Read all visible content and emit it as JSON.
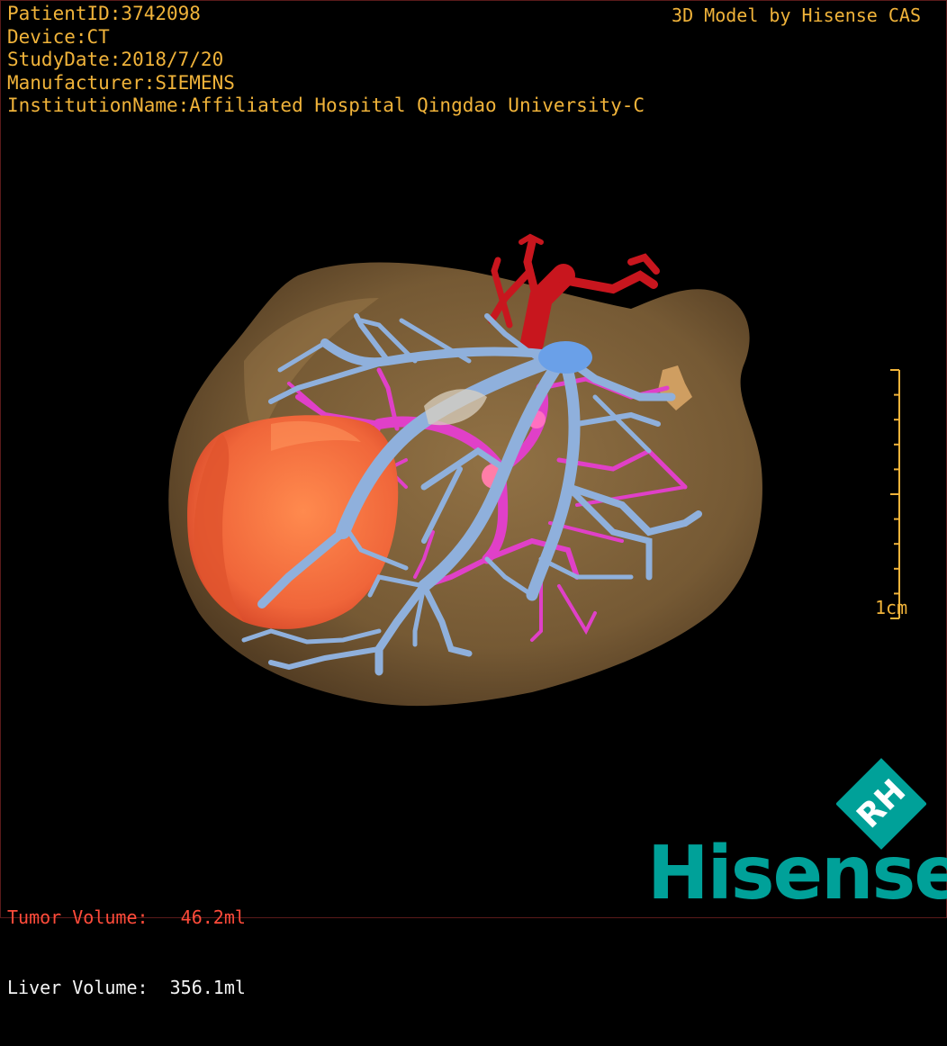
{
  "study": {
    "patient_id": "PatientID:3742098",
    "device": "Device:CT",
    "study_date": "StudyDate:2018/7/20",
    "manufacturer": "Manufacturer:SIEMENS",
    "institution": "InstitutionName:Affiliated Hospital Qingdao University-C"
  },
  "credit": "3D Model by Hisense CAS",
  "scale_bar": {
    "label": "1cm"
  },
  "volumes": {
    "tumor": "Tumor Volume:   46.2ml",
    "liver": "Liver Volume:  356.1ml"
  },
  "brand": {
    "wordmark": "Hisense",
    "emblem_text": "RH",
    "color": "#00a199"
  },
  "colors": {
    "overlay_text": "#f0b33a",
    "tumor_text": "#ff4b3a",
    "liver": "#8a6a3e",
    "tumor": "#f26a3a",
    "hepatic_vein": "#8fb0dc",
    "portal_vein": "#e040c8",
    "artery": "#c8161e"
  },
  "icons": [
    "liver-3d-model",
    "tumor-mesh",
    "hepatic-vein-tree",
    "portal-vein-tree",
    "hepatic-artery",
    "hisense-logo"
  ]
}
